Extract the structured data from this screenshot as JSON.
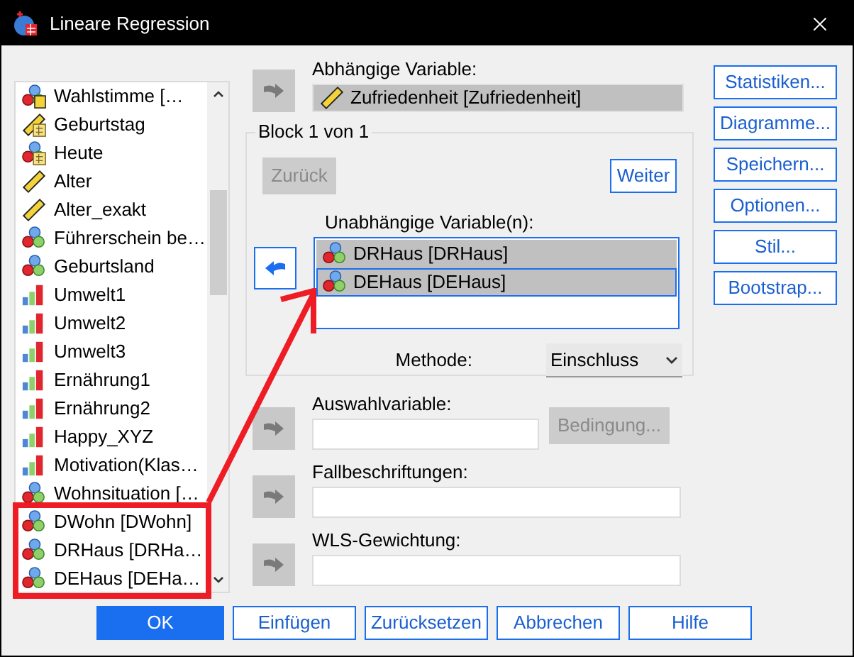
{
  "window": {
    "title": "Lineare Regression"
  },
  "variables": [
    {
      "name": "Wahlstimme […",
      "kind": "nominal-string"
    },
    {
      "name": "Geburtstag",
      "kind": "scale-date"
    },
    {
      "name": "Heute",
      "kind": "nominal-date"
    },
    {
      "name": "Alter",
      "kind": "scale"
    },
    {
      "name": "Alter_exakt",
      "kind": "scale"
    },
    {
      "name": "Führerschein be…",
      "kind": "nominal"
    },
    {
      "name": "Geburtsland",
      "kind": "nominal"
    },
    {
      "name": "Umwelt1",
      "kind": "ordinal"
    },
    {
      "name": "Umwelt2",
      "kind": "ordinal"
    },
    {
      "name": "Umwelt3",
      "kind": "ordinal"
    },
    {
      "name": "Ernährung1",
      "kind": "ordinal"
    },
    {
      "name": "Ernährung2",
      "kind": "ordinal"
    },
    {
      "name": "Happy_XYZ",
      "kind": "ordinal"
    },
    {
      "name": "Motivation(Klas…",
      "kind": "ordinal"
    },
    {
      "name": "Wohnsituation […",
      "kind": "nominal"
    },
    {
      "name": "DWohn [DWohn]",
      "kind": "nominal"
    },
    {
      "name": "DRHaus [DRHa…",
      "kind": "nominal"
    },
    {
      "name": "DEHaus [DEHa…",
      "kind": "nominal"
    }
  ],
  "dependent": {
    "label": "Abhängige Variable:",
    "value": "Zufriedenheit [Zufriedenheit]",
    "kind": "scale",
    "arrow_disabled": true
  },
  "block": {
    "title": "Block 1 von 1",
    "back_button": {
      "label": "Zurück",
      "disabled": true
    },
    "next_button": {
      "label": "Weiter",
      "disabled": false
    },
    "arrow_disabled": false,
    "independent_label": "Unabhängige Variable(n):",
    "independent": [
      {
        "name": "DRHaus [DRHaus]",
        "kind": "nominal",
        "selected": true,
        "focused": false
      },
      {
        "name": "DEHaus [DEHaus]",
        "kind": "nominal",
        "selected": true,
        "focused": true
      }
    ],
    "method_label": "Methode:",
    "method": "Einschluss"
  },
  "selection": {
    "label": "Auswahlvariable:",
    "arrow_disabled": true,
    "condition_button": {
      "label": "Bedingung...",
      "disabled": true
    }
  },
  "case_labels": {
    "label": "Fallbeschriftungen:",
    "arrow_disabled": true
  },
  "wls": {
    "label": "WLS-Gewichtung:",
    "arrow_disabled": true
  },
  "side_buttons": [
    "Statistiken...",
    "Diagramme...",
    "Speichern...",
    "Optionen...",
    "Stil...",
    "Bootstrap..."
  ],
  "bottom_buttons": [
    {
      "label": "OK",
      "default": true
    },
    {
      "label": "Einfügen",
      "default": false
    },
    {
      "label": "Zurücksetzen",
      "default": false
    },
    {
      "label": "Abbrechen",
      "default": false
    },
    {
      "label": "Hilfe",
      "default": false
    }
  ]
}
